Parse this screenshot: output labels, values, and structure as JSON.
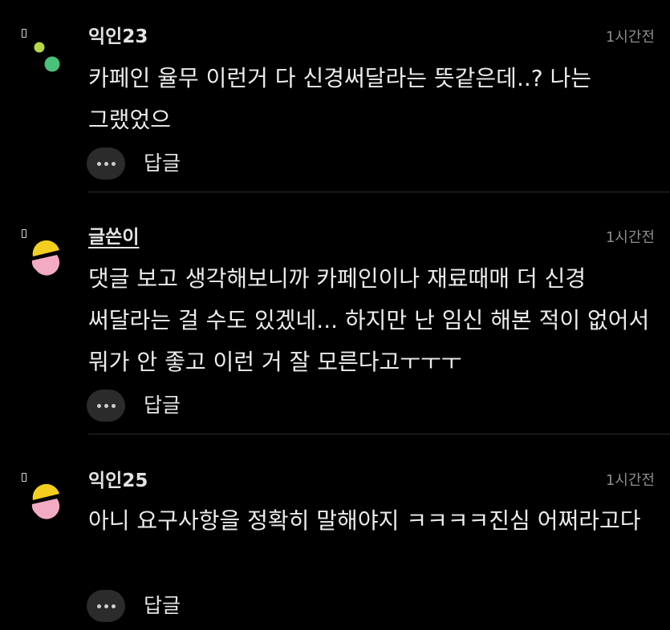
{
  "comments": [
    {
      "author": "익인23",
      "time": "1시간전",
      "text": "카페인 율무 이런거 다 신경써달라는 뜻같은데..? 나는 그랬었으",
      "reply_label": "답글",
      "avatar": "dots-avatar-icon",
      "colors": {
        "dot1": "#b7d84a",
        "dot2": "#49c178"
      }
    },
    {
      "author": "글쓴이",
      "time": "1시간전",
      "text": "댓글 보고 생각해보니까 카페인이나 재료때매 더 신경 써달라는 걸 수도 있겠네... 하지만 난 임신 해본 적이 없어서 뭐가 안 좋고 이런 거 잘 모른다고ㅜㅜㅜ",
      "reply_label": "답글",
      "avatar": "shape-avatar-icon",
      "colors": {
        "yellow": "#f3ce1f",
        "pink": "#f3aac3"
      }
    },
    {
      "author": "익인25",
      "time": "1시간전",
      "text": "아니 요구사항을 정확히 말해야지 ㅋㅋㅋㅋ진심 어쩌라고다",
      "reply_label": "답글",
      "avatar": "shape-avatar-icon",
      "colors": {
        "yellow": "#f3ce1f",
        "pink": "#f3aac3"
      }
    }
  ],
  "theme": {
    "background": "#000000",
    "text": "#ececec",
    "muted": "#8d8d8d",
    "button_bg": "#2b2b2b"
  }
}
